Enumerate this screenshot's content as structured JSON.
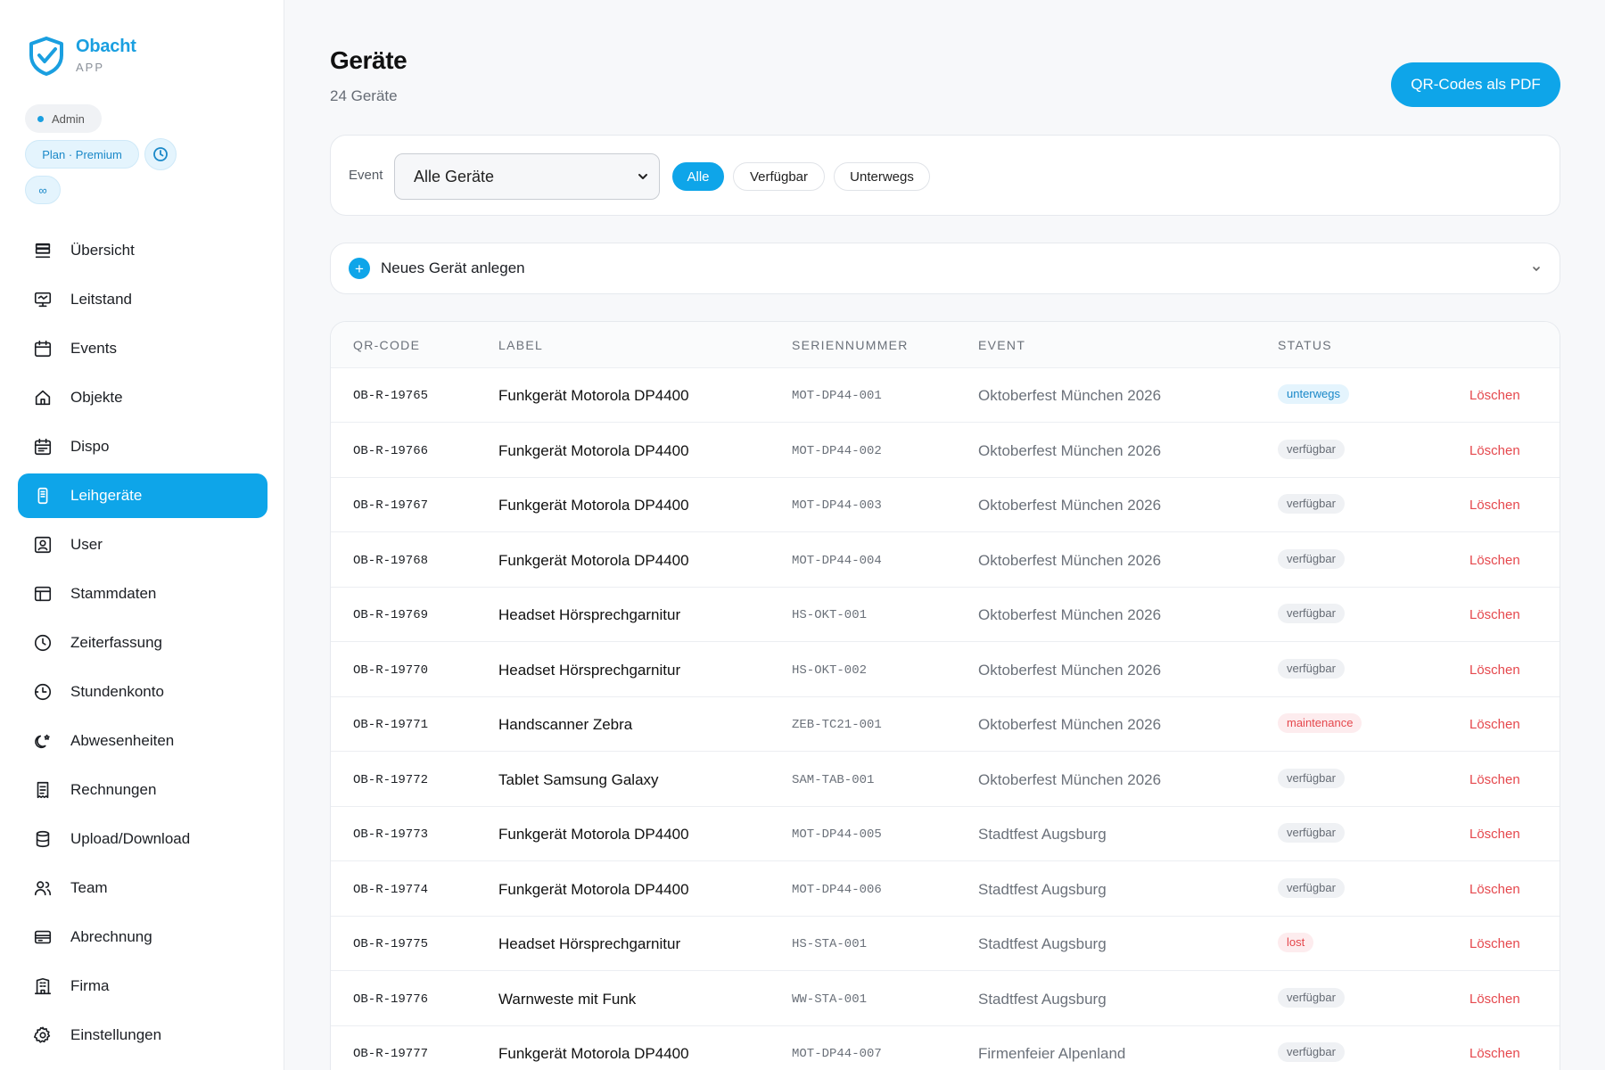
{
  "brand": {
    "name": "Obacht",
    "sub": "APP"
  },
  "badges": {
    "role": "Admin",
    "plan": "Plan · Premium",
    "infinity": "∞"
  },
  "nav": [
    {
      "label": "Übersicht",
      "icon": "layers-icon"
    },
    {
      "label": "Leitstand",
      "icon": "monitor-icon"
    },
    {
      "label": "Events",
      "icon": "calendar-icon"
    },
    {
      "label": "Objekte",
      "icon": "home-icon"
    },
    {
      "label": "Dispo",
      "icon": "calendar-list-icon"
    },
    {
      "label": "Leihgeräte",
      "icon": "device-icon",
      "active": true
    },
    {
      "label": "User",
      "icon": "user-badge-icon"
    },
    {
      "label": "Stammdaten",
      "icon": "table-layout-icon"
    },
    {
      "label": "Zeiterfassung",
      "icon": "clock-icon"
    },
    {
      "label": "Stundenkonto",
      "icon": "clock-history-icon"
    },
    {
      "label": "Abwesenheiten",
      "icon": "moon-star-icon"
    },
    {
      "label": "Rechnungen",
      "icon": "receipt-icon"
    },
    {
      "label": "Upload/Download",
      "icon": "database-icon"
    },
    {
      "label": "Team",
      "icon": "users-icon"
    },
    {
      "label": "Abrechnung",
      "icon": "credit-card-icon"
    },
    {
      "label": "Firma",
      "icon": "building-icon"
    },
    {
      "label": "Einstellungen",
      "icon": "gear-icon"
    }
  ],
  "header": {
    "title": "Geräte",
    "subtitle": "24 Geräte",
    "qr_button": "QR-Codes als PDF"
  },
  "filter": {
    "label": "Event",
    "select_value": "Alle Geräte",
    "chips": [
      {
        "label": "Alle",
        "active": true
      },
      {
        "label": "Verfügbar",
        "active": false
      },
      {
        "label": "Unterwegs",
        "active": false
      }
    ]
  },
  "new_device": {
    "label": "Neues Gerät anlegen"
  },
  "table": {
    "columns": [
      "QR-CODE",
      "LABEL",
      "SERIENNUMMER",
      "EVENT",
      "STATUS"
    ],
    "delete_label": "Löschen",
    "rows": [
      {
        "qr": "OB-R-19765",
        "label": "Funkgerät Motorola DP4400",
        "serial": "MOT-DP44-001",
        "event": "Oktoberfest München 2026",
        "status": "unterwegs",
        "status_class": "unterwegs"
      },
      {
        "qr": "OB-R-19766",
        "label": "Funkgerät Motorola DP4400",
        "serial": "MOT-DP44-002",
        "event": "Oktoberfest München 2026",
        "status": "verfügbar",
        "status_class": "verfuegbar"
      },
      {
        "qr": "OB-R-19767",
        "label": "Funkgerät Motorola DP4400",
        "serial": "MOT-DP44-003",
        "event": "Oktoberfest München 2026",
        "status": "verfügbar",
        "status_class": "verfuegbar"
      },
      {
        "qr": "OB-R-19768",
        "label": "Funkgerät Motorola DP4400",
        "serial": "MOT-DP44-004",
        "event": "Oktoberfest München 2026",
        "status": "verfügbar",
        "status_class": "verfuegbar"
      },
      {
        "qr": "OB-R-19769",
        "label": "Headset Hörsprechgarnitur",
        "serial": "HS-OKT-001",
        "event": "Oktoberfest München 2026",
        "status": "verfügbar",
        "status_class": "verfuegbar"
      },
      {
        "qr": "OB-R-19770",
        "label": "Headset Hörsprechgarnitur",
        "serial": "HS-OKT-002",
        "event": "Oktoberfest München 2026",
        "status": "verfügbar",
        "status_class": "verfuegbar"
      },
      {
        "qr": "OB-R-19771",
        "label": "Handscanner Zebra",
        "serial": "ZEB-TC21-001",
        "event": "Oktoberfest München 2026",
        "status": "maintenance",
        "status_class": "maintenance"
      },
      {
        "qr": "OB-R-19772",
        "label": "Tablet Samsung Galaxy",
        "serial": "SAM-TAB-001",
        "event": "Oktoberfest München 2026",
        "status": "verfügbar",
        "status_class": "verfuegbar"
      },
      {
        "qr": "OB-R-19773",
        "label": "Funkgerät Motorola DP4400",
        "serial": "MOT-DP44-005",
        "event": "Stadtfest Augsburg",
        "status": "verfügbar",
        "status_class": "verfuegbar"
      },
      {
        "qr": "OB-R-19774",
        "label": "Funkgerät Motorola DP4400",
        "serial": "MOT-DP44-006",
        "event": "Stadtfest Augsburg",
        "status": "verfügbar",
        "status_class": "verfuegbar"
      },
      {
        "qr": "OB-R-19775",
        "label": "Headset Hörsprechgarnitur",
        "serial": "HS-STA-001",
        "event": "Stadtfest Augsburg",
        "status": "lost",
        "status_class": "lost"
      },
      {
        "qr": "OB-R-19776",
        "label": "Warnweste mit Funk",
        "serial": "WW-STA-001",
        "event": "Stadtfest Augsburg",
        "status": "verfügbar",
        "status_class": "verfuegbar"
      },
      {
        "qr": "OB-R-19777",
        "label": "Funkgerät Motorola DP4400",
        "serial": "MOT-DP44-007",
        "event": "Firmenfeier Alpenland",
        "status": "verfügbar",
        "status_class": "verfuegbar"
      }
    ]
  },
  "colors": {
    "accent": "#0ea5e9",
    "danger": "#e5484d"
  }
}
